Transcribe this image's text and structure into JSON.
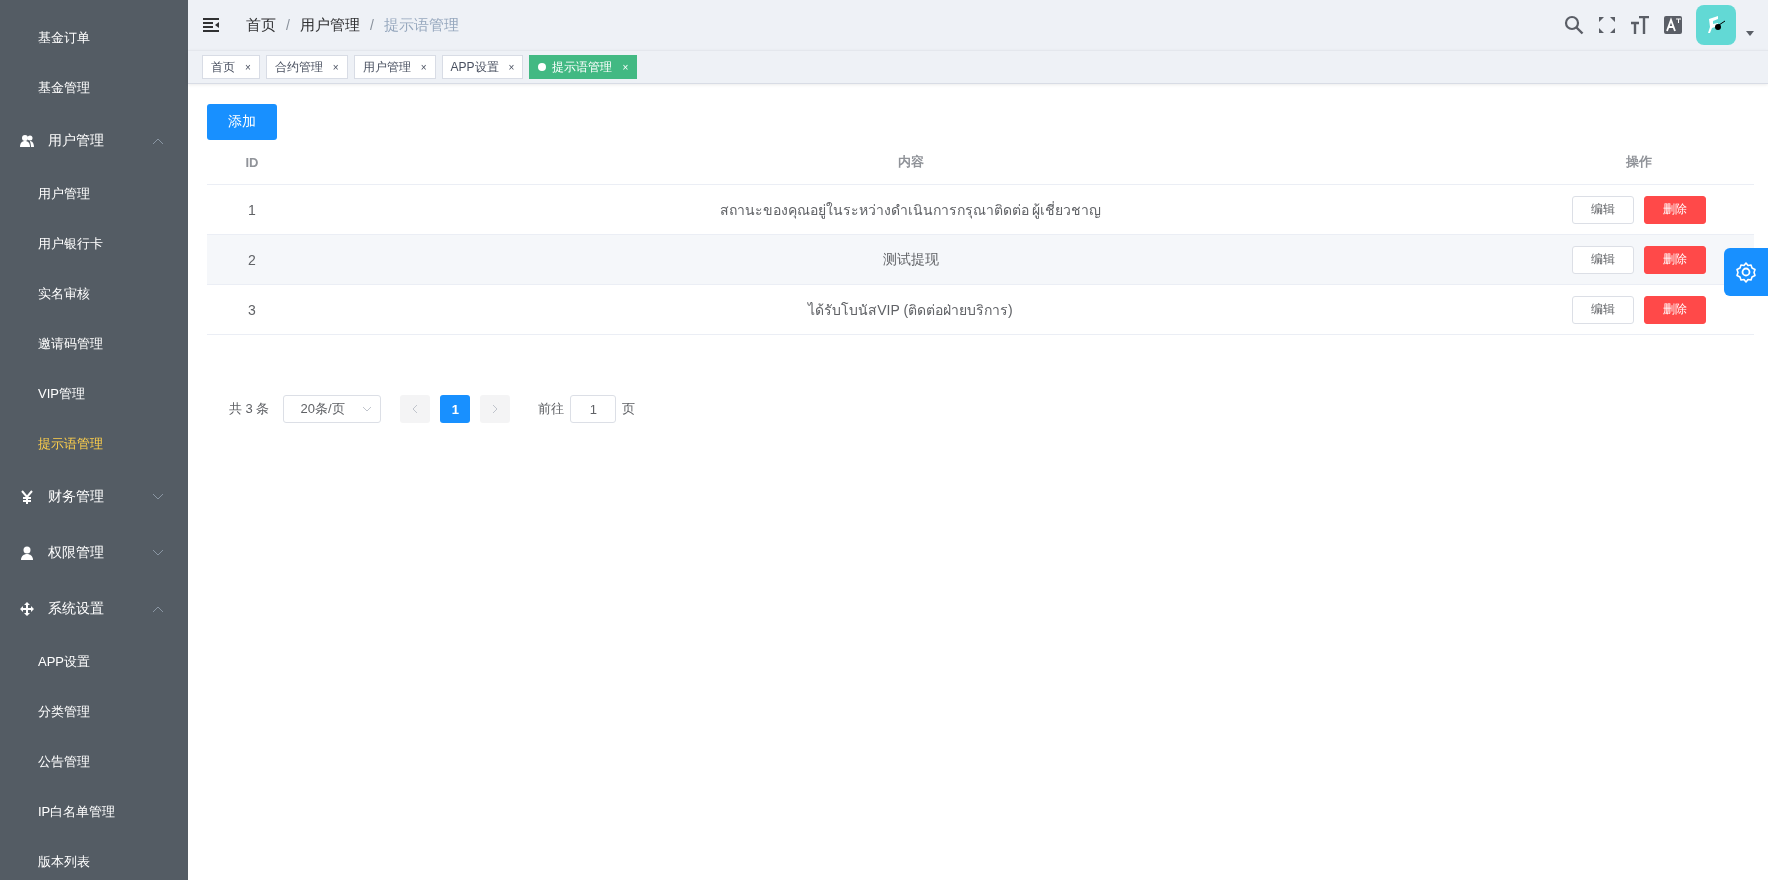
{
  "sidebar": {
    "items": [
      {
        "kind": "link",
        "label": "基金订单",
        "selected": false
      },
      {
        "kind": "link",
        "label": "基金管理",
        "selected": false
      },
      {
        "kind": "group",
        "label": "用户管理",
        "expanded": true,
        "children": [
          {
            "label": "用户管理",
            "selected": false
          },
          {
            "label": "用户银行卡",
            "selected": false
          },
          {
            "label": "实名审核",
            "selected": false
          },
          {
            "label": "邀请码管理",
            "selected": false
          },
          {
            "label": "VIP管理",
            "selected": false
          },
          {
            "label": "提示语管理",
            "selected": true
          }
        ]
      },
      {
        "kind": "group",
        "label": "财务管理",
        "expanded": false
      },
      {
        "kind": "group",
        "label": "权限管理",
        "expanded": false
      },
      {
        "kind": "group",
        "label": "系统设置",
        "expanded": true,
        "children": [
          {
            "label": "APP设置",
            "selected": false
          },
          {
            "label": "分类管理",
            "selected": false
          },
          {
            "label": "公告管理",
            "selected": false
          },
          {
            "label": "IP白名单管理",
            "selected": false
          },
          {
            "label": "版本列表",
            "selected": false
          }
        ]
      }
    ]
  },
  "breadcrumb": [
    "首页",
    "用户管理",
    "提示语管理"
  ],
  "breadcrumb_separator": "/",
  "tabs": [
    {
      "label": "首页",
      "close": "×",
      "selected": false
    },
    {
      "label": "合约管理",
      "close": "×",
      "selected": false
    },
    {
      "label": "用户管理",
      "close": "×",
      "selected": false
    },
    {
      "label": "APP设置",
      "close": "×",
      "selected": false
    },
    {
      "label": "提示语管理",
      "close": "×",
      "selected": true
    }
  ],
  "add_button": "添加",
  "table": {
    "columns": [
      "ID",
      "内容",
      "操作"
    ],
    "rows": [
      {
        "id": "1",
        "content": "สถานะของคุณอยู่ในระหว่างดำเนินการกรุณาติดต่อ ผู้เชี่ยวชาญ",
        "actions": [
          "编辑",
          "删除"
        ]
      },
      {
        "id": "2",
        "content": "测试提现",
        "actions": [
          "编辑",
          "删除"
        ]
      },
      {
        "id": "3",
        "content": "ได้รับโบนัสVIP (ติดต่อฝ่ายบริการ)",
        "actions": [
          "编辑",
          "删除"
        ]
      }
    ]
  },
  "pagination": {
    "total": "共 3 条",
    "page_size": "20条/页",
    "pages": [
      {
        "label": "1",
        "selected": true
      }
    ],
    "goto_label": "前往",
    "goto_value": "1",
    "goto_suffix": "页"
  }
}
